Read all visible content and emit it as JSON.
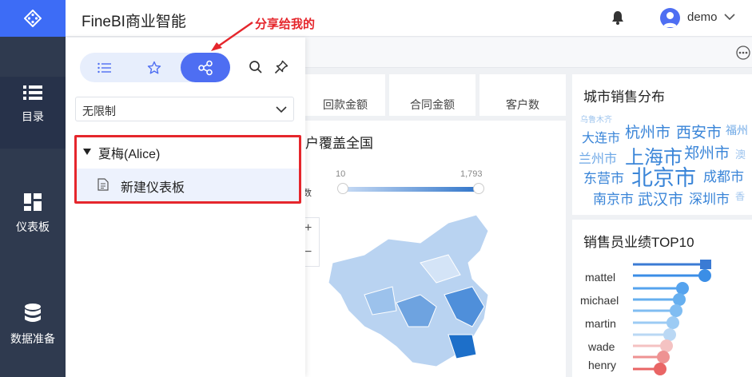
{
  "app": {
    "title": "FineBI商业智能"
  },
  "nav": {
    "items": [
      {
        "label": "目录",
        "icon": "list-icon"
      },
      {
        "label": "仪表板",
        "icon": "dashboard-icon"
      },
      {
        "label": "数据准备",
        "icon": "database-icon"
      }
    ]
  },
  "user": {
    "name": "demo"
  },
  "annotation": {
    "text": "分享给我的"
  },
  "panel": {
    "filter_value": "无限制",
    "tree": {
      "group_label": "夏梅(Alice)",
      "item_label": "新建仪表板"
    }
  },
  "dashboard": {
    "kpis": [
      "回款金额",
      "合同金额",
      "客户数"
    ],
    "map_title": "户覆盖全国",
    "legend": {
      "min": "10",
      "max": "1,793",
      "label": "户数"
    },
    "zoom": {
      "plus": "+",
      "minus": "−"
    },
    "wordcloud_title": "城市销售分布",
    "cities": [
      "乌鲁木齐",
      "大连市",
      "杭州市",
      "西安市",
      "福州",
      "兰州市",
      "上海市",
      "郑州市",
      "澳",
      "东营市",
      "北京市",
      "成都市",
      "南京市",
      "武汉市",
      "深圳市",
      "香"
    ],
    "top10_title": "销售员业绩TOP10",
    "top10_names": [
      "mattel",
      "michael",
      "martin",
      "wade",
      "henry"
    ]
  },
  "colors": {
    "accent": "#4e6ef2",
    "nav_bg": "#2f3a4f",
    "annotation": "#e5262c"
  }
}
